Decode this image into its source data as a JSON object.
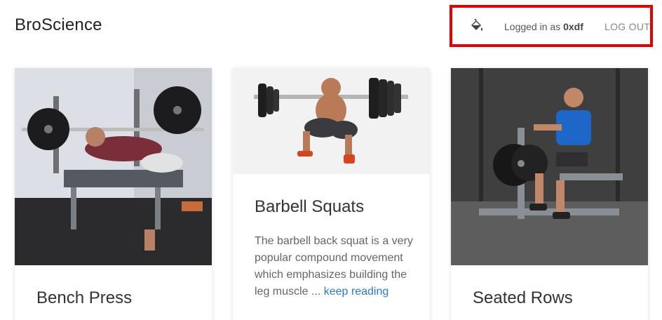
{
  "header": {
    "brand": "BroScience",
    "logged_in_prefix": "Logged in as",
    "username": "0xdf",
    "logout_label": "LOG OUT"
  },
  "cards": [
    {
      "title": "Bench Press"
    },
    {
      "title": "Barbell Squats",
      "description": "The barbell back squat is a very popular compound movement which emphasizes building the leg muscle ...",
      "link_label": "keep reading"
    },
    {
      "title": "Seated Rows"
    }
  ],
  "colors": {
    "highlight_border": "#e60000",
    "link": "#2a7bd0"
  },
  "icons": {
    "theme": "paint-bucket-icon"
  }
}
